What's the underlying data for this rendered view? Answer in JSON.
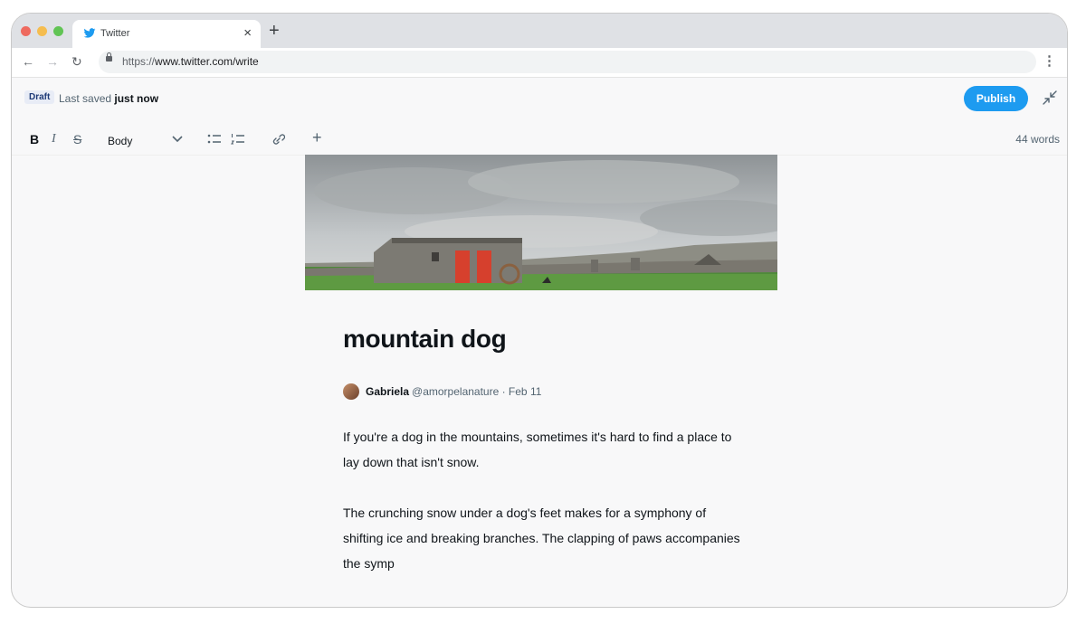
{
  "browser": {
    "tab_title": "Twitter",
    "tab_close": "×",
    "new_tab": "+",
    "url_prefix": "https://",
    "url_host": "www.twitter.com/write",
    "traffic_light_colors": [
      "#ee6a5f",
      "#f5bd4f",
      "#61c454"
    ]
  },
  "editor": {
    "draft_badge": "Draft",
    "saved_prefix": "Last saved",
    "saved_time": "just now",
    "publish_label": "Publish",
    "accent_color": "#1d9bf0",
    "toolbar": {
      "bold": "B",
      "italic": "I",
      "strike": "S",
      "style_select": "Body",
      "word_count": "44 words"
    }
  },
  "article": {
    "title": "mountain dog",
    "author_name": "Gabriela",
    "author_handle": "@amorpelanature · Feb 11",
    "paragraphs": [
      "If you're a dog in the mountains, sometimes it's hard to find a place to lay down that isn't snow.",
      "The crunching snow under a dog's feet makes for a symphony of shifting ice and breaking branches. The clapping of paws accompanies the symp"
    ]
  },
  "icons": [
    "back-arrow-icon",
    "forward-arrow-icon",
    "reload-icon",
    "lock-icon",
    "kebab-menu-icon",
    "collapse-icon",
    "bullet-list-icon",
    "numbered-list-icon",
    "link-icon",
    "add-icon",
    "chevron-down-icon",
    "twitter-bird-icon"
  ]
}
